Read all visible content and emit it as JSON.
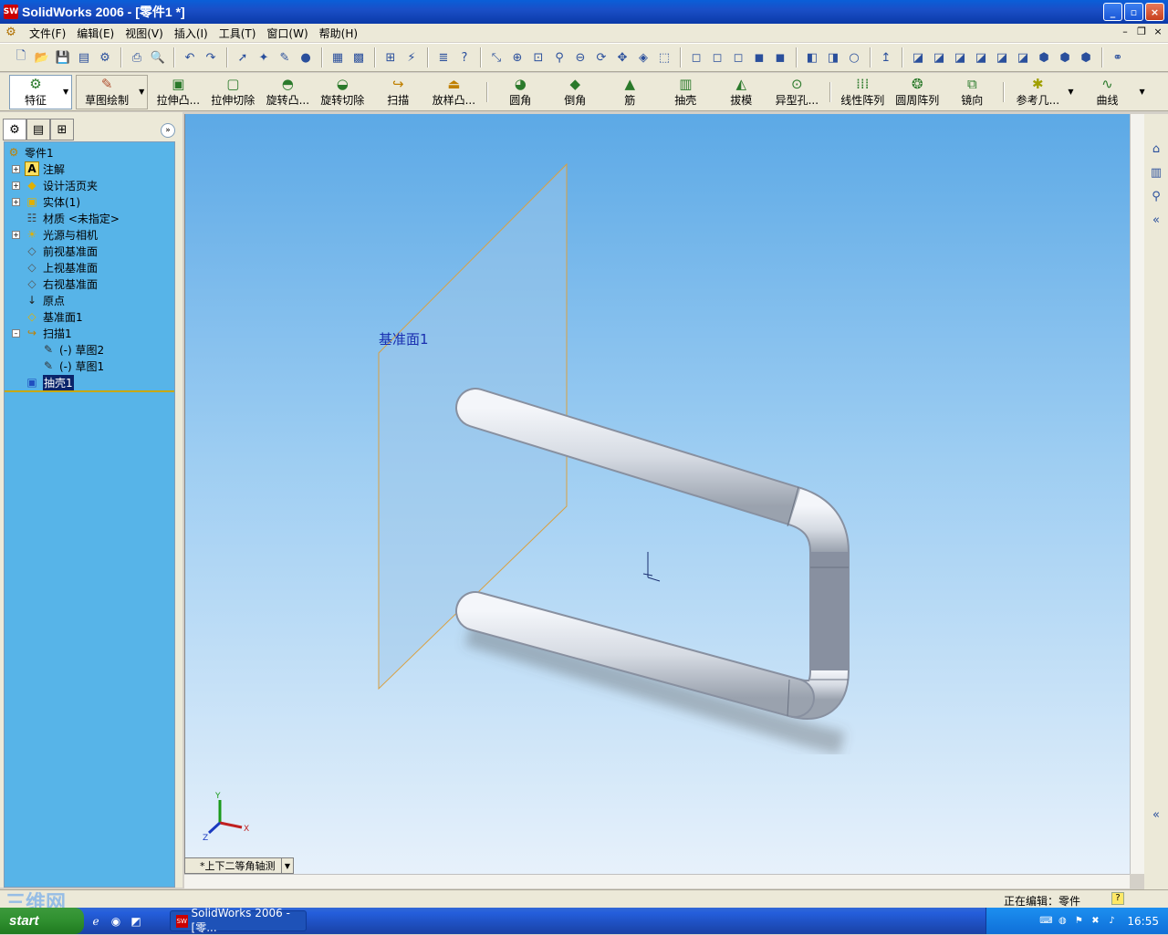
{
  "window": {
    "title": "SolidWorks 2006 - [零件1 *]",
    "app_icon_text": "SW"
  },
  "menu": [
    "文件(F)",
    "编辑(E)",
    "视图(V)",
    "插入(I)",
    "工具(T)",
    "窗口(W)",
    "帮助(H)"
  ],
  "features_toolbar": {
    "features_tab": "特征",
    "sketch_tab": "草图绘制",
    "buttons": [
      "拉伸凸...",
      "拉伸切除",
      "旋转凸...",
      "旋转切除",
      "扫描",
      "放样凸...",
      "圆角",
      "倒角",
      "筋",
      "抽壳",
      "拔模",
      "异型孔...",
      "线性阵列",
      "圆周阵列",
      "镜向",
      "参考几...",
      "曲线"
    ]
  },
  "tree": {
    "root": "零件1",
    "items": [
      {
        "label": "注解",
        "icon": "annotation-icon"
      },
      {
        "label": "设计活页夹",
        "icon": "design-binder-icon"
      },
      {
        "label": "实体(1)",
        "icon": "solid-bodies-icon"
      },
      {
        "label": "材质 <未指定>",
        "icon": "material-icon"
      },
      {
        "label": "光源与相机",
        "icon": "lights-cameras-icon"
      },
      {
        "label": "前视基准面",
        "icon": "plane-icon"
      },
      {
        "label": "上视基准面",
        "icon": "plane-icon"
      },
      {
        "label": "右视基准面",
        "icon": "plane-icon"
      },
      {
        "label": "原点",
        "icon": "origin-icon"
      },
      {
        "label": "基准面1",
        "icon": "plane-icon"
      },
      {
        "label": "扫描1",
        "icon": "sweep-icon"
      },
      {
        "label": "(-) 草图2",
        "icon": "sketch-icon"
      },
      {
        "label": "(-) 草图1",
        "icon": "sketch-icon"
      },
      {
        "label": "抽壳1",
        "icon": "shell-icon"
      }
    ]
  },
  "viewport": {
    "plane_label": "基准面1",
    "view_orientation": "*上下二等角轴测",
    "axes": {
      "x": "X",
      "y": "Y",
      "z": "Z"
    }
  },
  "status": {
    "editing": "正在编辑：零件",
    "help": "?"
  },
  "watermark": "三维网",
  "taskbar": {
    "start": "start",
    "task": "SolidWorks 2006 - [零...",
    "clock": "16:55"
  },
  "colors": {
    "titlebar": "#0a5fd8",
    "tree_bg": "#57b4e8",
    "selected": "#0a246a",
    "plane_edge": "#d9a040"
  }
}
